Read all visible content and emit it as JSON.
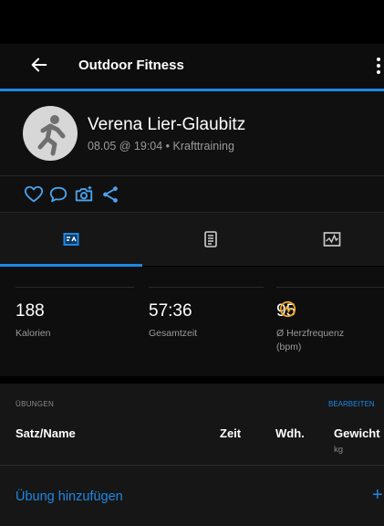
{
  "appbar": {
    "title": "Outdoor Fitness"
  },
  "profile": {
    "name": "Verena Lier-Glaubitz",
    "subtitle": "08.05 @ 19:04 • Krafttraining"
  },
  "stats": [
    {
      "value": "188",
      "label": "Kalorien"
    },
    {
      "value": "57:36",
      "label": "Gesamtzeit"
    },
    {
      "value": "95",
      "label": "Ø Herzfrequenz (bpm)"
    }
  ],
  "exercises": {
    "section_title": "ÜBUNGEN",
    "edit_label": "BEARBEITEN",
    "columns": {
      "name": "Satz/Name",
      "time": "Zeit",
      "reps": "Wdh.",
      "weight": "Gewicht",
      "weight_unit": "kg"
    },
    "add_label": "Übung hinzufügen",
    "add_symbol": "+"
  },
  "colors": {
    "accent": "#1e88e5",
    "heart_rate": "#f5a623",
    "background": "#000000"
  },
  "icons": [
    "back-arrow-icon",
    "more-vert-icon",
    "runner-icon",
    "heart-icon",
    "comment-icon",
    "camera-icon",
    "share-icon",
    "stats-tab-icon",
    "details-tab-icon",
    "chart-tab-icon",
    "heart-rate-icon"
  ]
}
